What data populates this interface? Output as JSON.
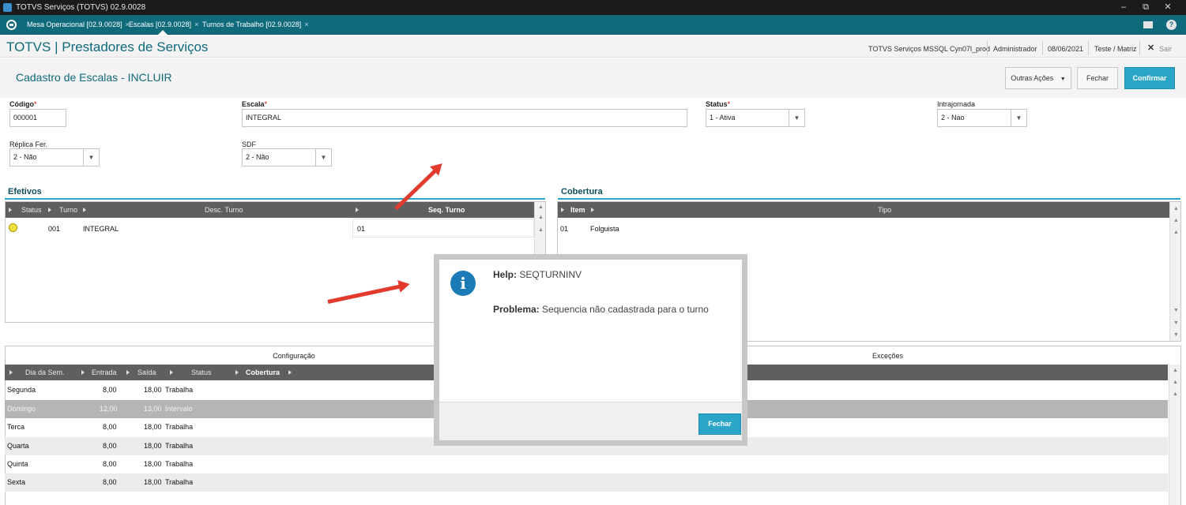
{
  "window": {
    "title": "TOTVS Serviços (TOTVS) 02.9.0028"
  },
  "tabs": [
    {
      "label": "Mesa Operacional [02.9.0028]"
    },
    {
      "label": "Escalas [02.9.0028]"
    },
    {
      "label": "Turnos de Trabalho [02.9.0028]"
    }
  ],
  "header": {
    "app_title": "TOTVS | Prestadores de Serviços",
    "environment": "TOTVS Serviços MSSQL Cyn07l_prod",
    "user": "Administrador",
    "date": "08/06/2021",
    "branch": "Teste / Matriz",
    "exit_label": "Sair"
  },
  "form": {
    "title": "Cadastro de Escalas - INCLUIR",
    "buttons": {
      "other_actions": "Outras Ações",
      "close": "Fechar",
      "confirm": "Confirmar"
    },
    "fields": {
      "codigo": {
        "label": "Código",
        "value": "000001"
      },
      "escala": {
        "label": "Escala",
        "value": "INTEGRAL"
      },
      "status": {
        "label": "Status",
        "value": "1 - Ativa"
      },
      "intrajornada": {
        "label": "Intrajornada",
        "value": "2 - Nao"
      },
      "replica_fer": {
        "label": "Réplica Fer.",
        "value": "2 - Não"
      },
      "sdf": {
        "label": "SDF",
        "value": "2 - Não"
      }
    },
    "required_marker": "*"
  },
  "efetivos": {
    "title": "Efetivos",
    "columns": [
      "Status",
      "Turno",
      "Desc. Turno",
      "Seq. Turno"
    ],
    "rows": [
      {
        "status": "yellow",
        "turno": "001",
        "desc": "INTEGRAL",
        "seq": "01"
      }
    ]
  },
  "cobertura": {
    "title": "Cobertura",
    "columns": [
      "Item",
      "Tipo"
    ],
    "rows": [
      {
        "item": "01",
        "tipo": "Folguista"
      }
    ]
  },
  "bottom_tabs": {
    "config": "Configuração",
    "excecoes": "Exceções"
  },
  "config_grid": {
    "columns": [
      "Dia da Sem.",
      "Entrada",
      "Saída",
      "Status",
      "Cobertura"
    ],
    "rows": [
      {
        "dia": "Segunda",
        "entrada": "8,00",
        "saida": "18,00",
        "status": "Trabalha"
      },
      {
        "dia": "Domingo",
        "entrada": "12,00",
        "saida": "13,00",
        "status": "Intervalo"
      },
      {
        "dia": "Terca",
        "entrada": "8,00",
        "saida": "18,00",
        "status": "Trabalha"
      },
      {
        "dia": "Quarta",
        "entrada": "8,00",
        "saida": "18,00",
        "status": "Trabalha"
      },
      {
        "dia": "Quinta",
        "entrada": "8,00",
        "saida": "18,00",
        "status": "Trabalha"
      },
      {
        "dia": "Sexta",
        "entrada": "8,00",
        "saida": "18,00",
        "status": "Trabalha"
      }
    ]
  },
  "dialog": {
    "help_label": "Help:",
    "help_code": "SEQTURNINV",
    "problem_label": "Problema:",
    "problem_text": "Sequencia não cadastrada para o turno",
    "close_button": "Fechar",
    "icon_glyph": "i"
  },
  "colors": {
    "accent": "#0f6a7c",
    "primary_button": "#2aa5c7",
    "annotation_arrow": "#e23b2e",
    "grid_header": "#5f5f5f"
  }
}
